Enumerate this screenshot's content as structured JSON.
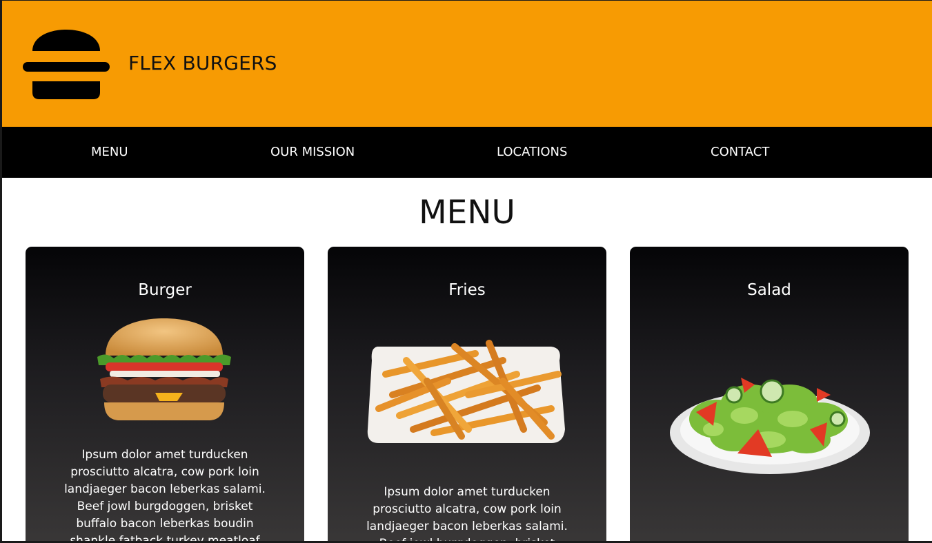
{
  "brand": {
    "name": "FLEX BURGERS",
    "logo": "burger-icon",
    "color": "#f79b03"
  },
  "nav": {
    "items": [
      {
        "label": "MENU"
      },
      {
        "label": "OUR MISSION"
      },
      {
        "label": "LOCATIONS"
      },
      {
        "label": "CONTACT"
      }
    ]
  },
  "section": {
    "title": "MENU"
  },
  "cards": [
    {
      "title": "Burger",
      "image": "burger-photo",
      "description": "Ipsum dolor amet turducken prosciutto alcatra, cow pork loin landjaeger bacon leberkas salami. Beef jowl burgdoggen, brisket buffalo bacon leberkas boudin shankle fatback turkey meatloaf shank"
    },
    {
      "title": "Fries",
      "image": "fries-photo",
      "description": "Ipsum dolor amet turducken prosciutto alcatra, cow pork loin landjaeger bacon leberkas salami. Beef jowl burgdoggen, brisket buffalo"
    },
    {
      "title": "Salad",
      "image": "salad-photo",
      "description": ""
    }
  ]
}
